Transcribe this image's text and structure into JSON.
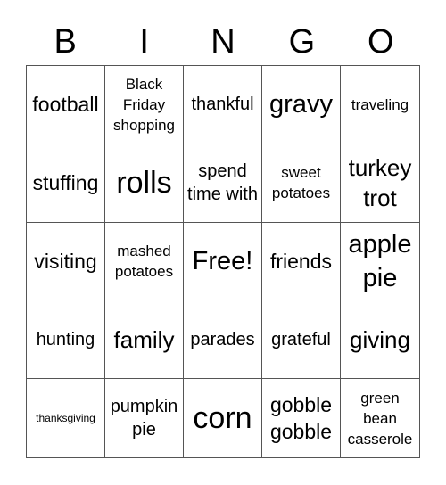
{
  "header": [
    "B",
    "I",
    "N",
    "G",
    "O"
  ],
  "cells": [
    {
      "text": "football"
    },
    {
      "text": "Black Friday shopping"
    },
    {
      "text": "thankful"
    },
    {
      "text": "gravy"
    },
    {
      "text": "traveling"
    },
    {
      "text": "stuffing"
    },
    {
      "text": "rolls"
    },
    {
      "text": "spend time with"
    },
    {
      "text": "sweet potatoes"
    },
    {
      "text": "turkey trot"
    },
    {
      "text": "visiting"
    },
    {
      "text": "mashed potatoes"
    },
    {
      "text": "Free!"
    },
    {
      "text": "friends"
    },
    {
      "text": "apple pie"
    },
    {
      "text": "hunting"
    },
    {
      "text": "family"
    },
    {
      "text": "parades"
    },
    {
      "text": "grateful"
    },
    {
      "text": "giving"
    },
    {
      "text": "thanksgiving"
    },
    {
      "text": "pumpkin pie"
    },
    {
      "text": "corn"
    },
    {
      "text": "gobble gobble"
    },
    {
      "text": "green bean casserole"
    }
  ]
}
